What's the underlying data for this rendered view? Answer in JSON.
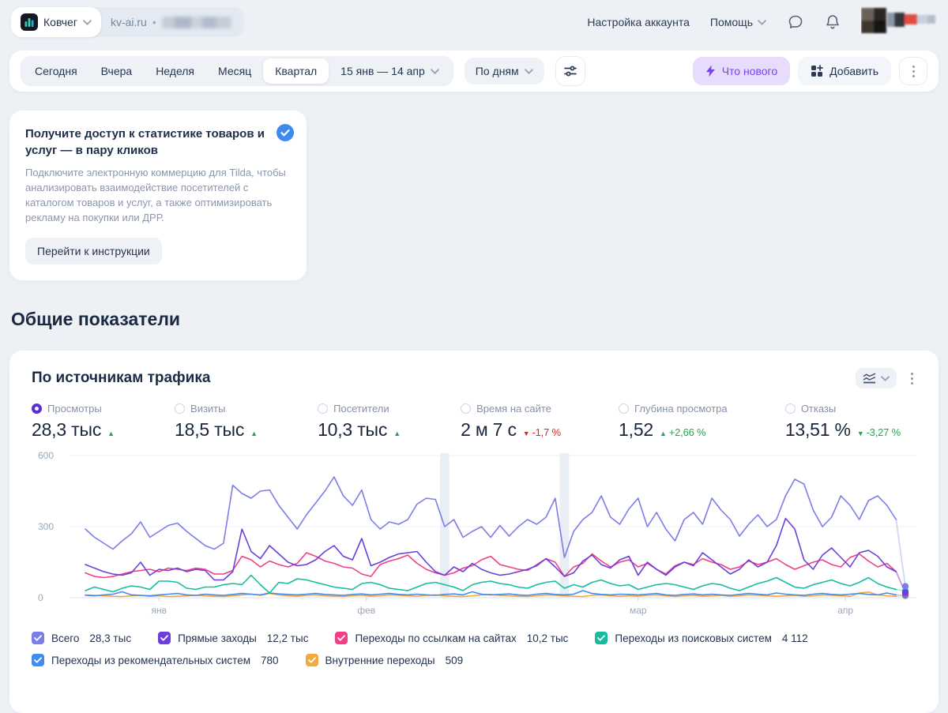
{
  "header": {
    "counter_name": "Ковчег",
    "counter_domain": "kv-ai.ru",
    "nav": {
      "account_settings": "Настройка аккаунта",
      "help": "Помощь"
    }
  },
  "filter_bar": {
    "tabs": [
      "Сегодня",
      "Вчера",
      "Неделя",
      "Месяц",
      "Квартал"
    ],
    "selected_tab": "Квартал",
    "date_range": "15 янв — 14 апр",
    "granularity": "По дням",
    "whats_new": "Что нового",
    "add": "Добавить"
  },
  "promo": {
    "title": "Получите доступ к статистике товаров и услуг — в пару кликов",
    "body": "Подключите электронную коммерцию для Tilda, чтобы анализировать взаимодействие посетителей с каталогом товаров и услуг, а также оптимизировать рекламу на покупки или ДРР.",
    "button": "Перейти к инструкции"
  },
  "section_title": "Общие показатели",
  "card": {
    "title": "По источникам трафика",
    "metrics": [
      {
        "label": "Просмотры",
        "value": "28,3 тыс",
        "trend": "up",
        "delta": "",
        "sentiment": "positive",
        "selected": true
      },
      {
        "label": "Визиты",
        "value": "18,5 тыс",
        "trend": "up",
        "delta": "",
        "sentiment": "positive",
        "selected": false
      },
      {
        "label": "Посетители",
        "value": "10,3 тыс",
        "trend": "up",
        "delta": "",
        "sentiment": "positive",
        "selected": false
      },
      {
        "label": "Время на сайте",
        "value": "2 м 7 с",
        "trend": "down",
        "delta": "-1,7 %",
        "sentiment": "negative",
        "selected": false
      },
      {
        "label": "Глубина просмотра",
        "value": "1,52",
        "trend": "up",
        "delta": "+2,66 %",
        "sentiment": "positive",
        "selected": false
      },
      {
        "label": "Отказы",
        "value": "13,51 %",
        "trend": "down",
        "delta": "-3,27 %",
        "sentiment": "positive",
        "selected": false
      }
    ]
  },
  "colors": {
    "positive": "#21a84e",
    "negative": "#e12517",
    "accent": "#5b2ed8",
    "whats_new_bg": "#e7dcfc",
    "whats_new_text": "#7a42ec",
    "promo_check": "#3e8af0"
  },
  "chart_data": {
    "type": "line",
    "x_unit": "day",
    "x_range": "15 янв — 14 апр",
    "n_points": 90,
    "ylim": [
      0,
      600
    ],
    "yticks": [
      0,
      300,
      600
    ],
    "grid": true,
    "legend_position": "bottom",
    "month_labels": [
      {
        "label": "янв",
        "day": 8
      },
      {
        "label": "фев",
        "day": 30.5
      },
      {
        "label": "мар",
        "day": 60
      },
      {
        "label": "апр",
        "day": 82.5
      }
    ],
    "holiday_bands": [
      {
        "day": 39
      },
      {
        "day": 52
      }
    ],
    "series": [
      {
        "name": "Всего",
        "value": "28,3 тыс",
        "color": "#7b7de8",
        "values": [
          290,
          255,
          230,
          205,
          240,
          270,
          320,
          255,
          280,
          305,
          315,
          280,
          250,
          220,
          205,
          230,
          475,
          440,
          420,
          450,
          455,
          390,
          340,
          290,
          350,
          400,
          450,
          510,
          430,
          390,
          455,
          330,
          290,
          320,
          310,
          330,
          395,
          420,
          415,
          300,
          330,
          255,
          280,
          300,
          255,
          305,
          260,
          300,
          330,
          310,
          340,
          420,
          170,
          280,
          330,
          360,
          430,
          340,
          310,
          375,
          420,
          300,
          360,
          290,
          240,
          330,
          360,
          310,
          420,
          370,
          330,
          260,
          310,
          350,
          300,
          330,
          430,
          500,
          480,
          370,
          300,
          340,
          430,
          390,
          330,
          410,
          430,
          390,
          330,
          48
        ]
      },
      {
        "name": "Прямые заходы",
        "value": "12,2 тыс",
        "color": "#6b3fdb",
        "values": [
          140,
          125,
          110,
          100,
          95,
          105,
          150,
          95,
          120,
          115,
          125,
          110,
          120,
          115,
          75,
          75,
          110,
          290,
          195,
          165,
          220,
          185,
          150,
          135,
          140,
          160,
          195,
          220,
          175,
          160,
          250,
          135,
          150,
          170,
          185,
          190,
          195,
          150,
          110,
          95,
          130,
          110,
          145,
          120,
          105,
          95,
          100,
          110,
          120,
          135,
          165,
          130,
          90,
          105,
          155,
          180,
          140,
          125,
          160,
          175,
          95,
          150,
          120,
          95,
          130,
          150,
          135,
          190,
          160,
          130,
          100,
          120,
          160,
          130,
          150,
          220,
          335,
          290,
          160,
          120,
          180,
          210,
          170,
          130,
          190,
          200,
          175,
          130,
          110,
          22
        ]
      },
      {
        "name": "Переходы по ссылкам на сайтах",
        "value": "10,2 тыс",
        "color": "#f23e87",
        "values": [
          105,
          90,
          85,
          90,
          100,
          110,
          115,
          120,
          110,
          125,
          120,
          115,
          125,
          120,
          100,
          100,
          115,
          175,
          160,
          130,
          155,
          140,
          130,
          145,
          190,
          175,
          155,
          145,
          130,
          125,
          100,
          90,
          140,
          155,
          165,
          180,
          145,
          120,
          105,
          95,
          105,
          125,
          135,
          160,
          175,
          140,
          130,
          120,
          115,
          140,
          165,
          150,
          90,
          130,
          145,
          185,
          155,
          130,
          150,
          160,
          130,
          145,
          120,
          100,
          135,
          150,
          140,
          165,
          150,
          140,
          120,
          130,
          155,
          140,
          150,
          165,
          140,
          120,
          135,
          150,
          160,
          140,
          130,
          170,
          185,
          155,
          130,
          145,
          110,
          18
        ]
      },
      {
        "name": "Переходы из поисковых систем",
        "value": "4 112",
        "color": "#13bd9e",
        "values": [
          30,
          45,
          35,
          25,
          40,
          50,
          45,
          35,
          70,
          70,
          65,
          40,
          35,
          45,
          45,
          55,
          60,
          55,
          95,
          55,
          20,
          65,
          60,
          80,
          75,
          65,
          55,
          45,
          40,
          35,
          60,
          65,
          55,
          40,
          35,
          30,
          45,
          60,
          65,
          55,
          45,
          30,
          55,
          65,
          70,
          60,
          55,
          45,
          40,
          55,
          65,
          70,
          40,
          55,
          45,
          65,
          75,
          60,
          50,
          55,
          35,
          45,
          55,
          60,
          55,
          45,
          35,
          50,
          60,
          55,
          40,
          30,
          45,
          60,
          70,
          85,
          65,
          45,
          40,
          55,
          65,
          75,
          60,
          50,
          65,
          85,
          60,
          45,
          35,
          28
        ]
      },
      {
        "name": "Переходы из рекомендательных систем",
        "value": "780",
        "color": "#3f8cf3",
        "values": [
          10,
          8,
          12,
          15,
          25,
          12,
          10,
          8,
          12,
          15,
          18,
          12,
          10,
          15,
          12,
          10,
          14,
          18,
          15,
          12,
          20,
          16,
          14,
          12,
          15,
          18,
          14,
          12,
          10,
          14,
          16,
          12,
          15,
          18,
          14,
          12,
          15,
          12,
          10,
          14,
          16,
          12,
          25,
          15,
          12,
          14,
          16,
          12,
          10,
          15,
          18,
          14,
          12,
          15,
          30,
          18,
          14,
          12,
          15,
          14,
          12,
          15,
          18,
          12,
          10,
          14,
          16,
          12,
          15,
          12,
          10,
          14,
          18,
          15,
          12,
          20,
          15,
          12,
          10,
          15,
          18,
          14,
          12,
          15,
          18,
          14,
          12,
          20,
          12,
          10
        ]
      },
      {
        "name": "Внутренние переходы",
        "value": "509",
        "color": "#f3a93b",
        "values": [
          12,
          10,
          8,
          6,
          5,
          8,
          10,
          6,
          8,
          5,
          6,
          8,
          10,
          8,
          6,
          5,
          8,
          12,
          15,
          10,
          18,
          12,
          8,
          6,
          10,
          12,
          8,
          6,
          5,
          8,
          10,
          6,
          8,
          12,
          10,
          8,
          6,
          10,
          12,
          8,
          6,
          5,
          8,
          12,
          14,
          10,
          8,
          6,
          5,
          8,
          12,
          10,
          8,
          6,
          5,
          10,
          12,
          8,
          6,
          8,
          6,
          10,
          12,
          8,
          5,
          8,
          10,
          6,
          8,
          10,
          6,
          8,
          12,
          10,
          8,
          6,
          8,
          10,
          6,
          8,
          12,
          10,
          8,
          6,
          20,
          24,
          12,
          8,
          6,
          8
        ]
      }
    ]
  }
}
